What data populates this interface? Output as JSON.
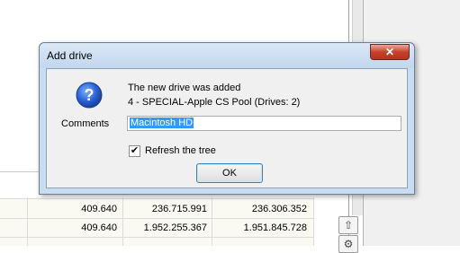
{
  "dialog": {
    "title": "Add drive",
    "close_glyph": "✕",
    "message_line1": "The new drive was added",
    "message_line2": "4 - SPECIAL-Apple CS Pool (Drives: 2)",
    "comments_label": "Comments",
    "comments_value": "Macintosh HD",
    "refresh_label": "Refresh the tree",
    "refresh_checked": true,
    "ok_label": "OK",
    "icon": "question-icon"
  },
  "background": {
    "table_rows": [
      [
        "409.640",
        "236.715.991",
        "236.306.352"
      ],
      [
        "409.640",
        "1.952.255.367",
        "1.951.845.728"
      ]
    ],
    "side_buttons": [
      "up-arrow-icon",
      "gear-icon"
    ]
  },
  "colors": {
    "title_bar": "#c9dcf0",
    "close_button": "#c7422c",
    "selection": "#3399ff"
  }
}
